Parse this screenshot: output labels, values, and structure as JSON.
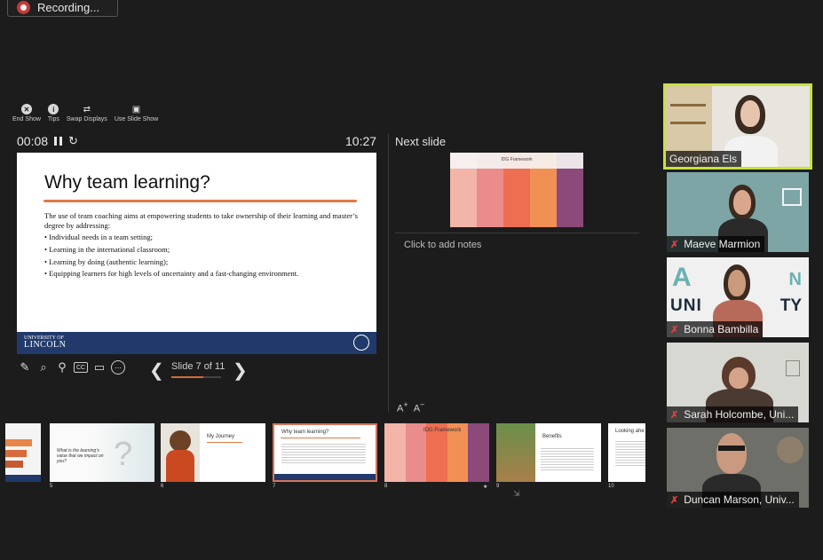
{
  "recording": {
    "label": "Recording..."
  },
  "toolbar": [
    {
      "label": "End Show",
      "icon": "end-show-icon"
    },
    {
      "label": "Tips",
      "icon": "info-icon"
    },
    {
      "label": "Swap Displays",
      "icon": "swap-icon"
    },
    {
      "label": "Use Slide Show",
      "icon": "slideshow-icon"
    }
  ],
  "presenter": {
    "elapsed": "00:08",
    "clock": "10:27",
    "next_label": "Next slide",
    "notes_placeholder": "Click to add notes",
    "slide_indicator": "Slide 7 of 11",
    "progress": 0.636,
    "font_up": "A",
    "font_down": "A"
  },
  "current_slide": {
    "title": "Why team learning?",
    "intro": "The use of team coaching aims at empowering students to take ownership of their learning and master’s degree by addressing:",
    "bullets": [
      "Individual needs in a team setting;",
      "Learning in the international classroom;",
      "Learning by doing (authentic learning);",
      "Equipping learners for high levels of uncertainty and a fast-changing environment."
    ],
    "footer_small": "UNIVERSITY OF",
    "footer_big": "LINCOLN"
  },
  "next_slide": {
    "title": "IDG Framework",
    "colors": [
      "#f2b5a8",
      "#eb8c8c",
      "#ee6e52",
      "#f19055",
      "#8b4a7a"
    ]
  },
  "thumbnails": [
    {
      "num": "",
      "title": ""
    },
    {
      "num": "5",
      "title": "What is the learning’s value that we impact on you?"
    },
    {
      "num": "6",
      "title": "My Journey"
    },
    {
      "num": "7",
      "title": "Why team learning?"
    },
    {
      "num": "8",
      "title": "IDG Framework"
    },
    {
      "num": "9",
      "title": "Benefits"
    },
    {
      "num": "10",
      "title": "Looking ahe"
    }
  ],
  "participants": [
    {
      "name": "Georgiana Els",
      "muted": false,
      "active": true
    },
    {
      "name": "Maeve Marmion",
      "muted": true,
      "active": false
    },
    {
      "name": "Bonna Bambilla",
      "muted": true,
      "active": false
    },
    {
      "name": "Sarah Holcombe, Uni...",
      "muted": true,
      "active": false
    },
    {
      "name": "Duncan Marson, Univ...",
      "muted": true,
      "active": false
    }
  ],
  "colors": {
    "accent": "#e07a45",
    "active_speaker": "#c7e23f",
    "lincoln_blue": "#213a6b",
    "muted": "#e34040"
  }
}
